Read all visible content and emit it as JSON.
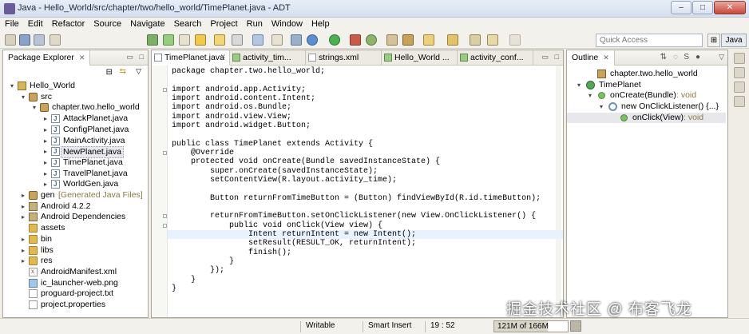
{
  "window": {
    "title": "Java - Hello_World/src/chapter/two/hello_world/TimePlanet.java - ADT",
    "buttons": [
      "–",
      "□",
      "✕"
    ]
  },
  "menu": [
    "File",
    "Edit",
    "Refactor",
    "Source",
    "Navigate",
    "Search",
    "Project",
    "Run",
    "Window",
    "Help"
  ],
  "toolbar": {
    "quick_access_placeholder": "Quick Access",
    "perspective": "Java"
  },
  "package_explorer": {
    "tab_label": "Package Explorer",
    "items": [
      {
        "label": "Hello_World",
        "icon": "project-icon",
        "twisty": "▾"
      },
      {
        "label": "src",
        "icon": "src-folder-icon",
        "twisty": "▾"
      },
      {
        "label": "chapter.two.hello_world",
        "icon": "package-icon",
        "twisty": "▾"
      },
      {
        "label": "AttackPlanet.java",
        "icon": "java-file-icon",
        "twisty": "▸"
      },
      {
        "label": "ConfigPlanet.java",
        "icon": "java-file-icon",
        "twisty": "▸"
      },
      {
        "label": "MainActivity.java",
        "icon": "java-file-icon",
        "twisty": "▸"
      },
      {
        "label": "NewPlanet.java",
        "icon": "java-file-icon",
        "twisty": "▸",
        "selected": true
      },
      {
        "label": "TimePlanet.java",
        "icon": "java-file-icon",
        "twisty": "▸"
      },
      {
        "label": "TravelPlanet.java",
        "icon": "java-file-icon",
        "twisty": "▸"
      },
      {
        "label": "WorldGen.java",
        "icon": "java-file-icon",
        "twisty": "▸"
      },
      {
        "label": "gen",
        "suffix": "[Generated Java Files]",
        "icon": "src-folder-icon",
        "twisty": "▸"
      },
      {
        "label": "Android 4.2.2",
        "icon": "library-icon",
        "twisty": "▸"
      },
      {
        "label": "Android Dependencies",
        "icon": "library-icon",
        "twisty": "▸"
      },
      {
        "label": "assets",
        "icon": "folder-icon",
        "twisty": ""
      },
      {
        "label": "bin",
        "icon": "folder-icon",
        "twisty": "▸"
      },
      {
        "label": "libs",
        "icon": "folder-icon",
        "twisty": "▸"
      },
      {
        "label": "res",
        "icon": "folder-icon",
        "twisty": "▸"
      },
      {
        "label": "AndroidManifest.xml",
        "icon": "xml-file-icon",
        "twisty": ""
      },
      {
        "label": "ic_launcher-web.png",
        "icon": "image-file-icon",
        "twisty": ""
      },
      {
        "label": "proguard-project.txt",
        "icon": "text-file-icon",
        "twisty": ""
      },
      {
        "label": "project.properties",
        "icon": "text-file-icon",
        "twisty": ""
      }
    ]
  },
  "editor": {
    "tabs": [
      "TimePlanet.java",
      "activity_tim...",
      "strings.xml",
      "Hello_World ...",
      "activity_conf..."
    ],
    "lines": [
      "package chapter.two.hello_world;",
      "",
      "import android.app.Activity;",
      "import android.content.Intent;",
      "import android.os.Bundle;",
      "import android.view.View;",
      "import android.widget.Button;",
      "",
      "public class TimePlanet extends Activity {",
      "    @Override",
      "    protected void onCreate(Bundle savedInstanceState) {",
      "        super.onCreate(savedInstanceState);",
      "        setContentView(R.layout.activity_time);",
      "",
      "        Button returnFromTimeButton = (Button) findViewById(R.id.timeButton);",
      "",
      "        returnFromTimeButton.setOnClickListener(new View.OnClickListener() {",
      "            public void onClick(View view) {",
      "                Intent returnIntent = new Intent();",
      "                setResult(RESULT_OK, returnIntent);",
      "                finish();",
      "            }",
      "        });",
      "    }",
      "}"
    ]
  },
  "outline": {
    "tab_label": "Outline",
    "items": [
      {
        "label": "chapter.two.hello_world",
        "type": "",
        "icon": "package-declaration-icon",
        "twisty": ""
      },
      {
        "label": "TimePlanet",
        "type": "",
        "icon": "class-icon",
        "twisty": "▾"
      },
      {
        "label": "onCreate(Bundle)",
        "type": " : void",
        "icon": "method-icon",
        "twisty": "▾"
      },
      {
        "label": "new OnClickListener() {...}",
        "type": "",
        "icon": "anonymous-class-icon",
        "twisty": "▾"
      },
      {
        "label": "onClick(View)",
        "type": " : void",
        "icon": "method-icon",
        "twisty": ""
      }
    ]
  },
  "status": {
    "writable": "Writable",
    "insert_mode": "Smart Insert",
    "position": "19 : 52",
    "heap": "121M of 166M",
    "heap_used_fraction": 0.73
  },
  "watermark": "掘金技术社区 @ 布客飞龙"
}
